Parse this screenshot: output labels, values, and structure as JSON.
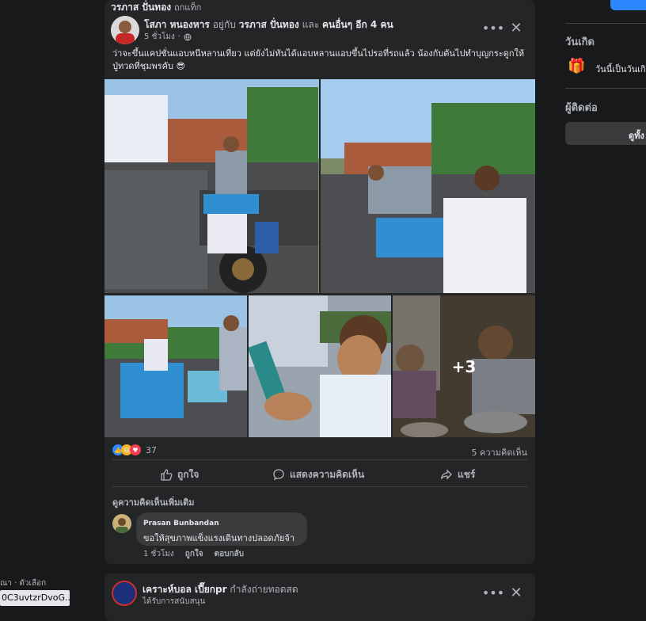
{
  "post": {
    "tagged_header": "วรภาส ปั่นทอง",
    "tagged_header_suffix": "ถูกแท็ก",
    "author": "โสภา หนองหาร",
    "with_text": "อยู่กับ",
    "with_name": "วรภาส ปั่นทอง",
    "and_text": "และ",
    "others": "คนอื่นๆ อีก 4 คน",
    "time": "5 ชั่วโมง",
    "body": "ว่าจะขึ้นแคปชั่นแอบหนีหลานเที่ยว แต่ยังไม่ทันได้แอบหลานแอบขึ้นไปรอที่รถแล้ว น้องกับตันไปทำบุญกระดูกให้ปู่ทวดที่ชุมพรคับ 😎",
    "more_photos": "+3",
    "reaction_count": "37",
    "comment_count": "5 ความคิดเห็น",
    "like_label": "ถูกใจ",
    "comment_label": "แสดงความคิดเห็น",
    "share_label": "แชร์",
    "view_more_comments": "ดูความคิดเห็นเพิ่มเติม",
    "comment": {
      "name": "Prasan Bunbandan",
      "text": "ขอให้สุขภาพแข็งแรงเดินทางปลอดภัยจ้า",
      "time": "1 ชั่วโมง",
      "like": "ถูกใจ",
      "reply": "ตอบกลับ"
    }
  },
  "next_post": {
    "author": "เคราะห์บอล เปี๊ยกpr",
    "action": "กำลังถ่ายทอดสด",
    "sub": "ได้รับการสนับสนุน"
  },
  "right_sidebar": {
    "birthday_heading": "วันเกิด",
    "birthday_text": "วันนี้เป็นวันเกิ",
    "contacts_heading": "ผู้ติดต่อ",
    "contacts_button": "ดูทั้ง"
  },
  "left_footer": {
    "text": "ณา · ตัวเลือก",
    "url_tooltip": "0C3uvtzrDvoG..."
  },
  "colors": {
    "accent": "#2d88ff",
    "card": "#242526",
    "bg": "#18191a"
  }
}
